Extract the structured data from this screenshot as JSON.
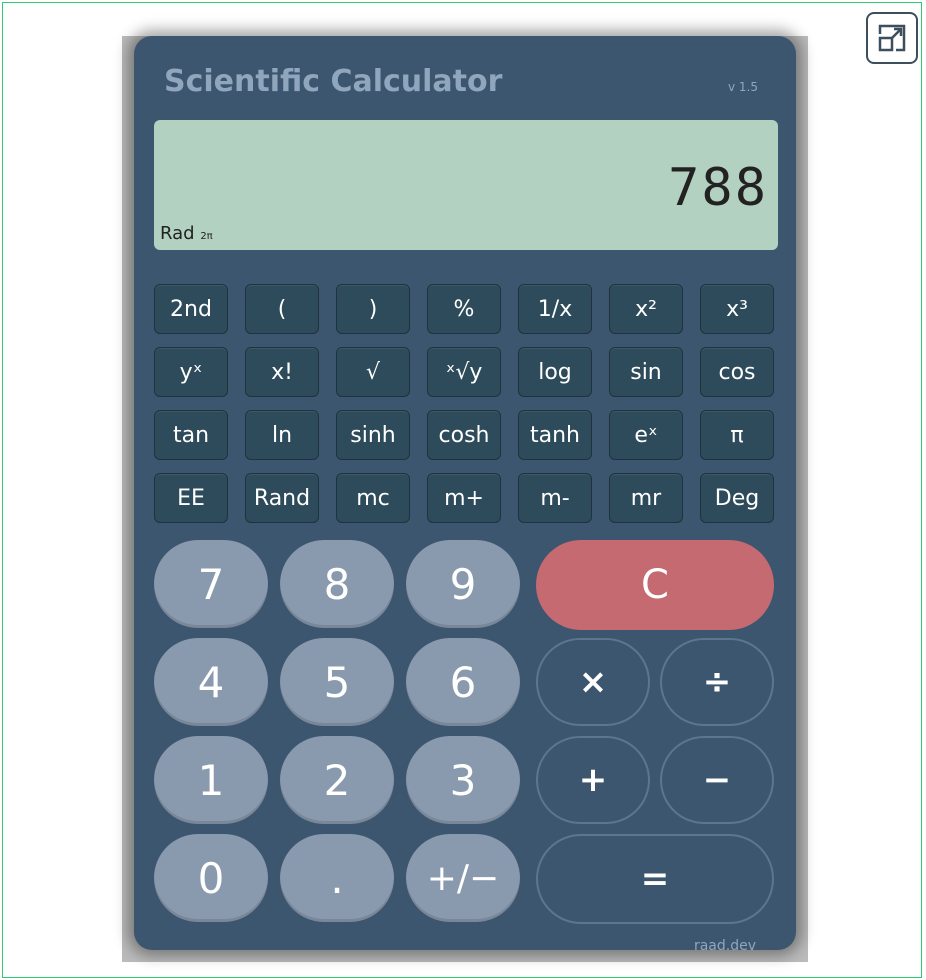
{
  "app": {
    "title": "Scientific Calculator",
    "version": "v 1.5",
    "brand": "raad.dev"
  },
  "display": {
    "value": "788",
    "mode": "Rad",
    "mode_sub": "2π"
  },
  "functions": [
    {
      "label": "2nd",
      "name": "2nd-button"
    },
    {
      "label": "(",
      "name": "open-paren-button"
    },
    {
      "label": ")",
      "name": "close-paren-button"
    },
    {
      "label": "%",
      "name": "percent-button"
    },
    {
      "label": "1/x",
      "name": "reciprocal-button"
    },
    {
      "label": "x²",
      "name": "square-button"
    },
    {
      "label": "x³",
      "name": "cube-button"
    },
    {
      "label": "yˣ",
      "name": "power-button"
    },
    {
      "label": "x!",
      "name": "factorial-button"
    },
    {
      "label": "√",
      "name": "sqrt-button"
    },
    {
      "label": "ˣ√y",
      "name": "xth-root-button"
    },
    {
      "label": "log",
      "name": "log-button"
    },
    {
      "label": "sin",
      "name": "sin-button"
    },
    {
      "label": "cos",
      "name": "cos-button"
    },
    {
      "label": "tan",
      "name": "tan-button"
    },
    {
      "label": "ln",
      "name": "ln-button"
    },
    {
      "label": "sinh",
      "name": "sinh-button"
    },
    {
      "label": "cosh",
      "name": "cosh-button"
    },
    {
      "label": "tanh",
      "name": "tanh-button"
    },
    {
      "label": "eˣ",
      "name": "exp-button"
    },
    {
      "label": "π",
      "name": "pi-button"
    },
    {
      "label": "EE",
      "name": "ee-button"
    },
    {
      "label": "Rand",
      "name": "rand-button"
    },
    {
      "label": "mc",
      "name": "memory-clear-button"
    },
    {
      "label": "m+",
      "name": "memory-add-button"
    },
    {
      "label": "m-",
      "name": "memory-subtract-button"
    },
    {
      "label": "mr",
      "name": "memory-recall-button"
    },
    {
      "label": "Deg",
      "name": "deg-button"
    }
  ],
  "keys": {
    "k7": "7",
    "k8": "8",
    "k9": "9",
    "k4": "4",
    "k5": "5",
    "k6": "6",
    "k1": "1",
    "k2": "2",
    "k3": "3",
    "k0": "0",
    "dot": ".",
    "sign": "+/−",
    "clear": "C",
    "multiply": "×",
    "divide": "÷",
    "add": "+",
    "subtract": "−",
    "equals": "="
  },
  "colors": {
    "body": "#3d566f",
    "display": "#b3d1c0",
    "number_key": "#8a9aae",
    "clear_key": "#c56a71",
    "function_key": "#2d4b5a",
    "frame_border": "#2ecc71"
  },
  "icons": {
    "expand": "expand-icon"
  }
}
